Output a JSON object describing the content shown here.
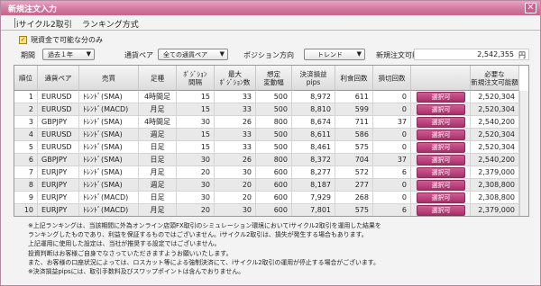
{
  "window": {
    "title": "新規注文入力",
    "close_glyph": "✕"
  },
  "tabs": [
    {
      "label": "iサイクル2取引"
    },
    {
      "label": "ランキング方式"
    }
  ],
  "options": {
    "checkbox_checked": true,
    "check_glyph": "✓",
    "label": "現資金で可能な分のみ"
  },
  "filters": {
    "period_label": "期間",
    "period_value": "過去１年",
    "pair_label": "通貨ペア",
    "pair_value": "全ての通貨ペア",
    "direction_label": "ポジション方向",
    "direction_value": "トレンド",
    "amount_label": "新規注文可能額",
    "amount_value": "2,542,355",
    "amount_unit": "円",
    "arrow_glyph": "▼"
  },
  "table": {
    "headers": [
      "順位",
      "通貨ペア",
      "売買",
      "足種",
      "ﾎﾟｼﾞｼｮﾝ\n間隔",
      "最大\nﾎﾟｼﾞｼｮﾝ数",
      "想定\n変動幅",
      "決済損益\npips",
      "利食回数",
      "損切回数",
      "",
      "必要な\n新規注文可能額"
    ],
    "select_label": "選択可",
    "rows": [
      {
        "rank": "1",
        "pair": "EURUSD",
        "trade": "ﾄﾚﾝﾄﾞ(SMA)",
        "bar": "4時間足",
        "interval": "15",
        "max_pos": "33",
        "range": "500",
        "pips": "8,972",
        "profit_count": "611",
        "loss_count": "0",
        "required": "2,520,304"
      },
      {
        "rank": "2",
        "pair": "EURUSD",
        "trade": "ﾄﾚﾝﾄﾞ(MACD)",
        "bar": "月足",
        "interval": "15",
        "max_pos": "33",
        "range": "500",
        "pips": "8,810",
        "profit_count": "599",
        "loss_count": "0",
        "required": "2,520,304"
      },
      {
        "rank": "3",
        "pair": "GBPJPY",
        "trade": "ﾄﾚﾝﾄﾞ(SMA)",
        "bar": "4時間足",
        "interval": "30",
        "max_pos": "26",
        "range": "800",
        "pips": "8,674",
        "profit_count": "711",
        "loss_count": "37",
        "required": "2,540,200"
      },
      {
        "rank": "4",
        "pair": "EURUSD",
        "trade": "ﾄﾚﾝﾄﾞ(SMA)",
        "bar": "週足",
        "interval": "15",
        "max_pos": "33",
        "range": "500",
        "pips": "8,611",
        "profit_count": "586",
        "loss_count": "0",
        "required": "2,520,304"
      },
      {
        "rank": "5",
        "pair": "EURUSD",
        "trade": "ﾄﾚﾝﾄﾞ(SMA)",
        "bar": "日足",
        "interval": "15",
        "max_pos": "33",
        "range": "500",
        "pips": "8,461",
        "profit_count": "575",
        "loss_count": "0",
        "required": "2,520,304"
      },
      {
        "rank": "6",
        "pair": "GBPJPY",
        "trade": "ﾄﾚﾝﾄﾞ(SMA)",
        "bar": "日足",
        "interval": "30",
        "max_pos": "26",
        "range": "800",
        "pips": "8,372",
        "profit_count": "704",
        "loss_count": "37",
        "required": "2,540,200"
      },
      {
        "rank": "7",
        "pair": "EURJPY",
        "trade": "ﾄﾚﾝﾄﾞ(SMA)",
        "bar": "月足",
        "interval": "20",
        "max_pos": "30",
        "range": "600",
        "pips": "8,277",
        "profit_count": "572",
        "loss_count": "6",
        "required": "2,379,000"
      },
      {
        "rank": "8",
        "pair": "EURJPY",
        "trade": "ﾄﾚﾝﾄﾞ(SMA)",
        "bar": "週足",
        "interval": "30",
        "max_pos": "20",
        "range": "600",
        "pips": "8,187",
        "profit_count": "277",
        "loss_count": "0",
        "required": "2,308,800"
      },
      {
        "rank": "9",
        "pair": "EURJPY",
        "trade": "ﾄﾚﾝﾄﾞ(MACD)",
        "bar": "日足",
        "interval": "30",
        "max_pos": "20",
        "range": "600",
        "pips": "7,929",
        "profit_count": "268",
        "loss_count": "0",
        "required": "2,308,800"
      },
      {
        "rank": "10",
        "pair": "EURJPY",
        "trade": "ﾄﾚﾝﾄﾞ(MACD)",
        "bar": "月足",
        "interval": "20",
        "max_pos": "30",
        "range": "600",
        "pips": "7,801",
        "profit_count": "575",
        "loss_count": "6",
        "required": "2,379,000"
      }
    ]
  },
  "notes": [
    "※上記ランキングは、当該期間に外為オンライン店頭FX取引のシミュレーション環境においてiサイクル2取引を運用した結果を",
    "ランキングしたものであり、利益を保証するものではございません。iサイクル2取引は、損失が発生する場合もあります。",
    "上記運用に使用した設定は、当社が推奨する設定ではございません。",
    "投資判断はお客様ご自身でなさっていただきますようお願いいたします。",
    "また、お客様の口座状況によっては、ロスカット等による強制決済にて、iサイクル2取引の運用が停止する場合がございます。",
    "※決済損益pipsには、取引手数料及びスワップポイントは含んでおりません。"
  ],
  "colors": {
    "title_bar": "#d2789f",
    "select_button": "#b83c78",
    "checkbox": "#ffe27a"
  }
}
